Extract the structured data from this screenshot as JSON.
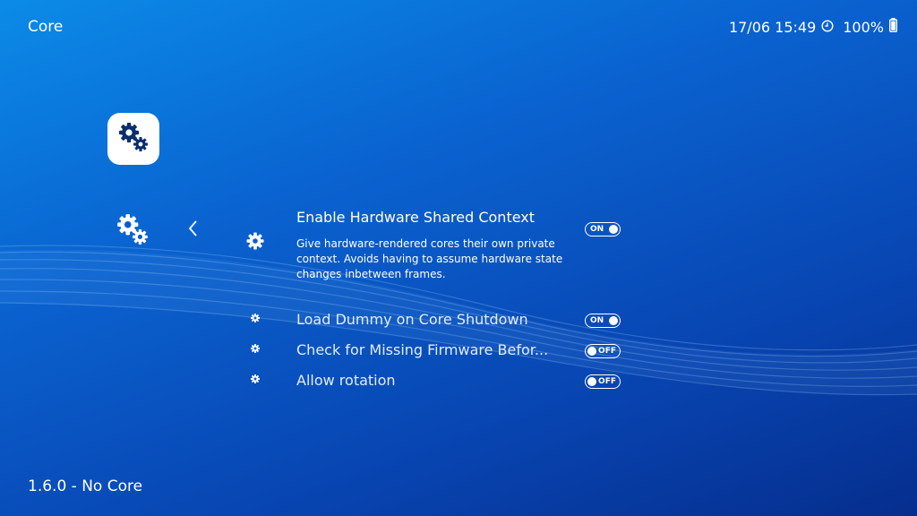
{
  "header": {
    "title": "Core",
    "datetime": "17/06 15:49",
    "clock_icon": "clock-icon",
    "battery": "100%",
    "battery_icon": "battery-icon"
  },
  "footer": {
    "version": "1.6.0 - No Core"
  },
  "sidebar": {
    "tile_icon": "settings-gears-icon",
    "category_icon": "settings-gears-icon",
    "back_icon": "chevron-left-icon"
  },
  "menu": {
    "selected": {
      "label": "Enable Hardware Shared Context",
      "description": "Give hardware-rendered cores their own private context. Avoids having to assume hardware state changes inbetween frames.",
      "value": "ON"
    },
    "items": [
      {
        "label": "Load Dummy on Core Shutdown",
        "value": "ON"
      },
      {
        "label": "Check for Missing Firmware Befor...",
        "value": "OFF"
      },
      {
        "label": "Allow rotation",
        "value": "OFF"
      }
    ]
  },
  "colors": {
    "background_top": "#0b8be8",
    "background_bottom": "#062e8e",
    "text": "#ffffff"
  }
}
